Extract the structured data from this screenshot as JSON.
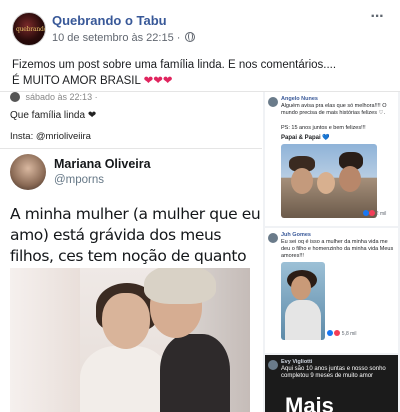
{
  "post": {
    "page_name": "Quebrando o Tabu",
    "avatar_text": "quebrando",
    "timestamp": "10 de setembro às 22:15 ·",
    "more_icon": "more-horizontal-icon",
    "caption_line1": "Fizemos um post sobre uma família linda. E nos comentários....",
    "caption_line2": "É MUITO AMOR BRASIL",
    "caption_hearts": "❤❤❤"
  },
  "tweet": {
    "insta_top": "sábado às 22:13 ·",
    "insta_caption": "Que família linda ❤",
    "insta_credit": "Insta: @mrioliveiira",
    "author_name": "Mariana Oliveira",
    "author_handle": "@mporns",
    "text": "A minha mulher (a mulher que eu amo) está grávida dos meus filhos, ces tem noção de quanto amor eu to sentindo?"
  },
  "comments": [
    {
      "name": "Angelo Nunes",
      "text": "Alguém avisa pra elas que só melhora!!!! O mundo precisa de mais histórias felizes ♡.",
      "ps": "PS: 15 anos juntos e bem felizes!!!",
      "signature": "Papai & Papai",
      "signature_heart": "💙",
      "reactions": "2 mil"
    },
    {
      "name": "Juh Gomes",
      "text": "Eu sei oq é isso a mulher da minha vida me deu o filho e homenzinho da minha vida Meus amores!!!",
      "reactions": "5,8 mil"
    },
    {
      "name": "Evy Vigliotti",
      "text": "Aqui são 10 anos juntas e nosso sonho completou 9 meses de muito amor",
      "big_text": "Mais"
    }
  ],
  "colors": {
    "link_blue": "#385898",
    "heart_red": "#e0245e",
    "fb_blue": "#1877f2"
  }
}
